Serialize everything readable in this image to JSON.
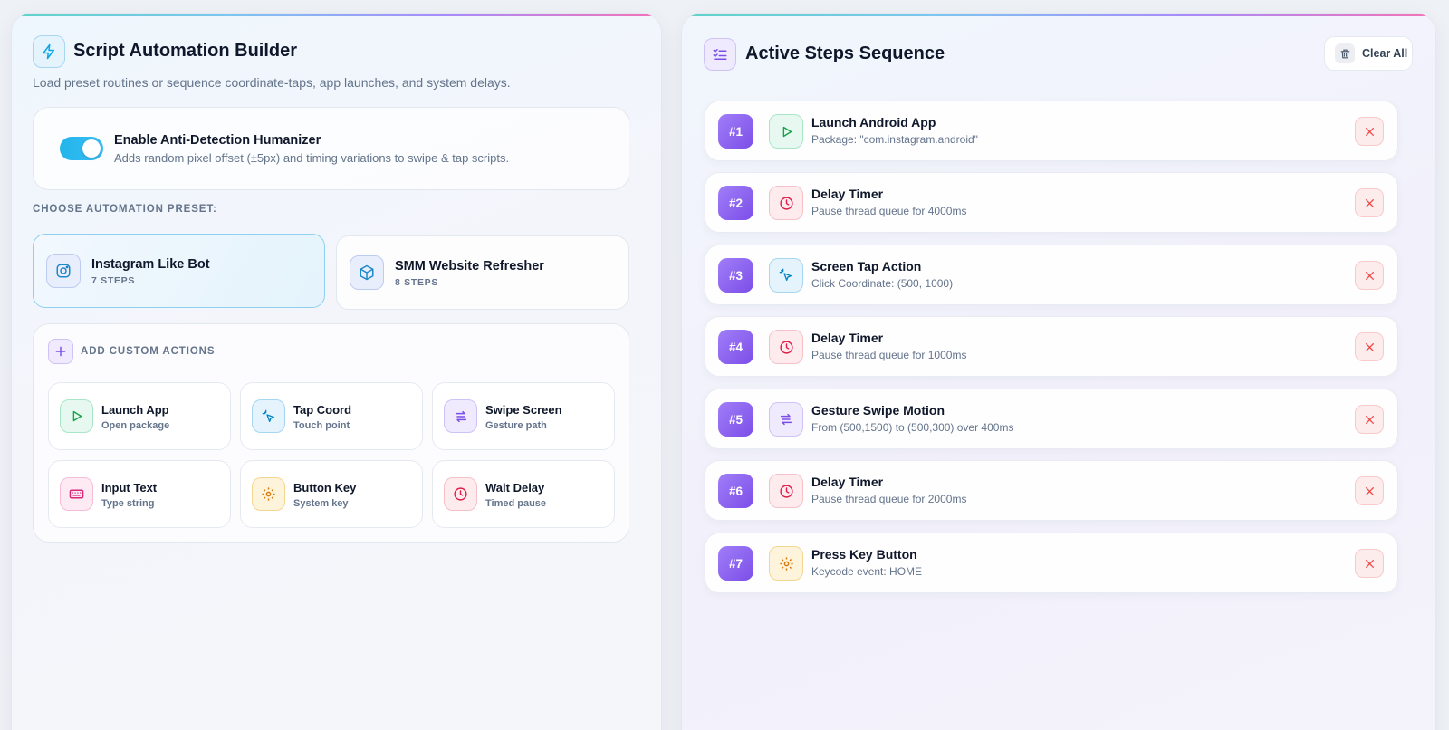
{
  "builder": {
    "title": "Script Automation Builder",
    "subtitle": "Load preset routines or sequence coordinate-taps, app launches, and system delays.",
    "header_icon": "lightning-icon"
  },
  "humanizer": {
    "title": "Enable Anti-Detection Humanizer",
    "description": "Adds random pixel offset (±5px) and timing variations to swipe & tap scripts.",
    "enabled": true
  },
  "presets": {
    "label": "CHOOSE AUTOMATION PRESET:",
    "items": [
      {
        "name": "Instagram Like Bot",
        "steps": "7 STEPS",
        "icon": "instagram-icon",
        "active": true
      },
      {
        "name": "SMM Website Refresher",
        "steps": "8 STEPS",
        "icon": "box-icon",
        "active": false
      }
    ]
  },
  "custom_actions": {
    "label": "ADD CUSTOM ACTIONS",
    "items": [
      {
        "title": "Launch App",
        "sub": "Open package",
        "icon": "play-icon"
      },
      {
        "title": "Tap Coord",
        "sub": "Touch point",
        "icon": "pointer-icon"
      },
      {
        "title": "Swipe Screen",
        "sub": "Gesture path",
        "icon": "swipe-arrows-icon"
      },
      {
        "title": "Input Text",
        "sub": "Type string",
        "icon": "keyboard-icon"
      },
      {
        "title": "Button Key",
        "sub": "System key",
        "icon": "gear-icon"
      },
      {
        "title": "Wait Delay",
        "sub": "Timed pause",
        "icon": "clock-icon"
      }
    ]
  },
  "sequence": {
    "title": "Active Steps Sequence",
    "clear_label": "Clear All",
    "steps": [
      {
        "num": "#1",
        "title": "Launch Android App",
        "desc": "Package: \"com.instagram.android\"",
        "icon": "play-icon"
      },
      {
        "num": "#2",
        "title": "Delay Timer",
        "desc": "Pause thread queue for 4000ms",
        "icon": "clock-icon"
      },
      {
        "num": "#3",
        "title": "Screen Tap Action",
        "desc": "Click Coordinate: (500, 1000)",
        "icon": "pointer-icon"
      },
      {
        "num": "#4",
        "title": "Delay Timer",
        "desc": "Pause thread queue for 1000ms",
        "icon": "clock-icon"
      },
      {
        "num": "#5",
        "title": "Gesture Swipe Motion",
        "desc": "From (500,1500) to (500,300) over 400ms",
        "icon": "swipe-arrows-icon"
      },
      {
        "num": "#6",
        "title": "Delay Timer",
        "desc": "Pause thread queue for 2000ms",
        "icon": "clock-icon"
      },
      {
        "num": "#7",
        "title": "Press Key Button",
        "desc": "Keycode event: HOME",
        "icon": "gear-icon"
      }
    ]
  },
  "colors": {
    "accent_sky": "#22b5ea",
    "accent_violet": "#7c4ee8",
    "danger": "#ef4444"
  }
}
